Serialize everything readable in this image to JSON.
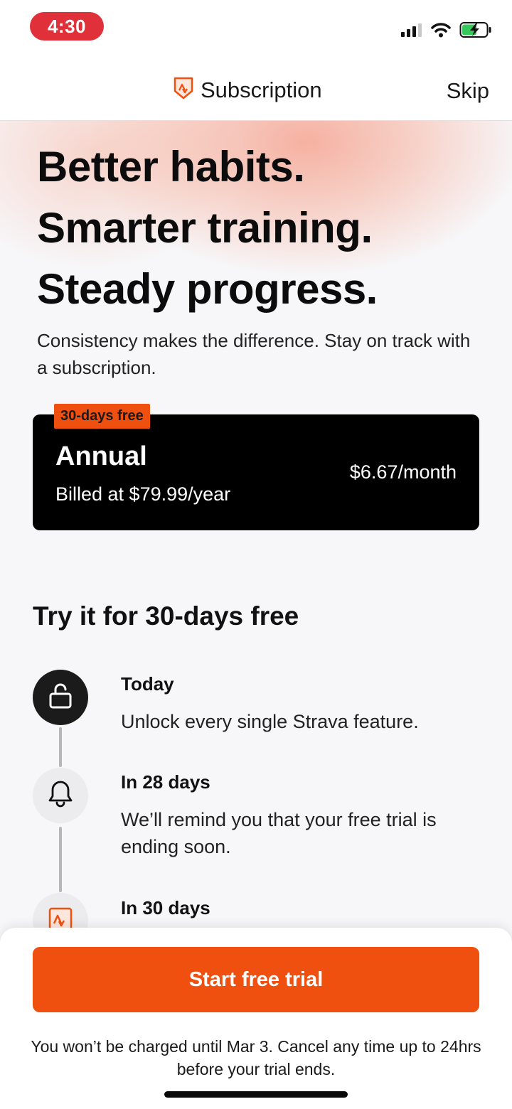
{
  "status_bar": {
    "time": "4:30",
    "icons": [
      "cellular-signal-icon",
      "wifi-icon",
      "battery-charging-icon"
    ],
    "pill_color": "#e0303a"
  },
  "header": {
    "title": "Subscription",
    "skip_label": "Skip",
    "logo_icon": "strava-shield-icon"
  },
  "hero": {
    "lines": [
      "Better habits.",
      "Smarter training.",
      "Steady progress."
    ],
    "subtext": "Consistency makes the difference. Stay on track with a subscription."
  },
  "plan": {
    "badge": "30-days free",
    "name": "Annual",
    "billed": "Billed at $79.99/year",
    "price": "$6.67/month"
  },
  "trial": {
    "title": "Try it for 30-days free",
    "steps": [
      {
        "icon": "unlock-icon",
        "label": "Today",
        "desc": "Unlock every single Strava feature."
      },
      {
        "icon": "bell-icon",
        "label": "In 28 days",
        "desc": "We’ll remind you that your free trial is ending soon."
      },
      {
        "icon": "strava-logo-icon",
        "label": "In 30 days",
        "desc": ""
      }
    ]
  },
  "footer": {
    "cta_label": "Start free trial",
    "disclaimer": "You won’t be charged until Mar 3. Cancel any time up to 24hrs before your trial ends."
  },
  "colors": {
    "brand_orange": "#f0500f",
    "card_black": "#000000",
    "background": "#f7f6f8"
  }
}
